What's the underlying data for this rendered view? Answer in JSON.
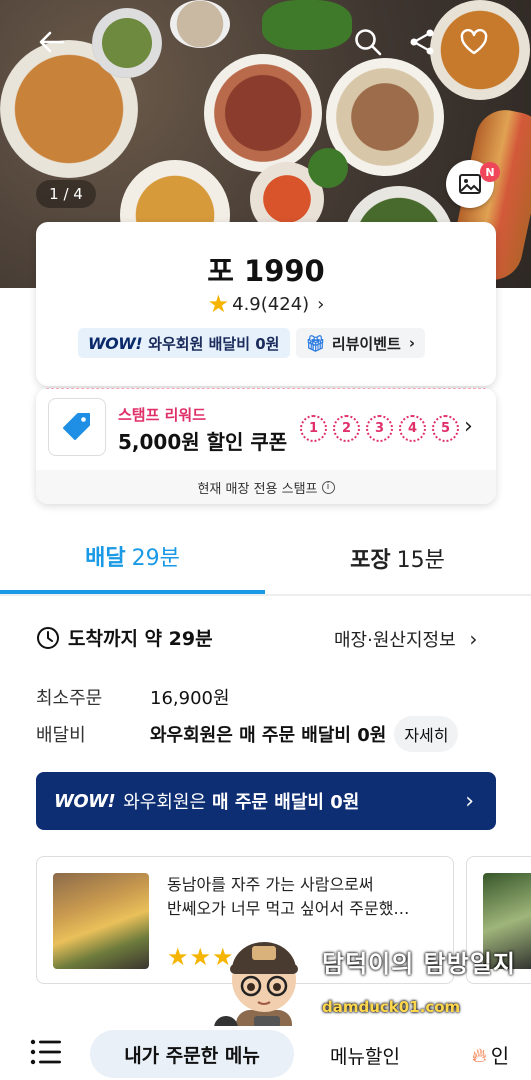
{
  "hero": {
    "photo_counter": "1 / 4",
    "new_badge": "N"
  },
  "store": {
    "name": "포 1990",
    "rating": "4.9",
    "review_count": "(424)",
    "wow_logo": "WOW!",
    "wow_tag": "와우회원 배달비 0원",
    "review_event": "리뷰이벤트"
  },
  "stamp": {
    "label": "스탬프 리워드",
    "title": "5,000원 할인 쿠폰",
    "stamps": [
      "1",
      "2",
      "3",
      "4",
      "5"
    ],
    "footer": "현재 매장 전용 스탬프"
  },
  "tabs": [
    {
      "name": "배달",
      "time": "29분"
    },
    {
      "name": "포장",
      "time": "15분"
    }
  ],
  "info": {
    "arrival": "도착까지 약 29분",
    "store_info": "매장·원산지정보",
    "min_order_label": "최소주문",
    "min_order_value": "16,900원",
    "fee_label": "배달비",
    "fee_value": "와우회원은 매 주문 배달비 0원",
    "detail_button": "자세히"
  },
  "wow_banner": {
    "logo": "WOW!",
    "prefix": "와우회원은",
    "bold": "매 주문 배달비 0원"
  },
  "review": {
    "line1": "동남아를 자주 가는 사람으로써",
    "line2": "반쎄오가 너무 먹고 싶어서 주문했…",
    "stars": "★★★"
  },
  "watermark": {
    "title": "담덕이의 탐방일지",
    "url": "damduck01.com"
  },
  "bottom_bar": {
    "my_menu": "내가 주문한 메뉴",
    "menu_discount": "메뉴할인",
    "hot_label": "인"
  },
  "colors": {
    "accent": "#1a9ae6",
    "wow_navy": "#0e2e74",
    "stamp_pink": "#e0306a",
    "star": "#f5b400"
  }
}
